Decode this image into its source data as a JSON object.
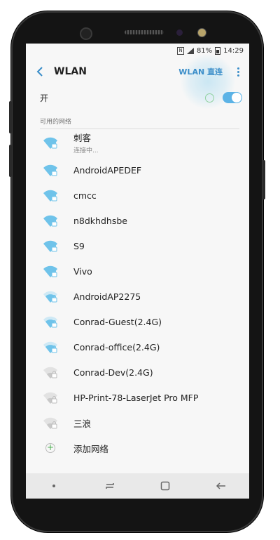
{
  "status_bar": {
    "nfc": "N",
    "battery_percent": "81%",
    "time": "14:29"
  },
  "app_bar": {
    "title": "WLAN",
    "wifi_direct_label": "WLAN 直连"
  },
  "master_switch": {
    "label": "开",
    "on": true
  },
  "section_header": "可用的网络",
  "networks": [
    {
      "name": "刺客",
      "status": "连接中..."
    },
    {
      "name": "AndroidAPEDEF"
    },
    {
      "name": "cmcc"
    },
    {
      "name": "n8dkhdhsbe"
    },
    {
      "name": "S9"
    },
    {
      "name": "Vivo"
    },
    {
      "name": "AndroidAP2275"
    },
    {
      "name": "Conrad-Guest(2.4G)"
    },
    {
      "name": "Conrad-office(2.4G)"
    },
    {
      "name": "Conrad-Dev(2.4G)"
    },
    {
      "name": "HP-Print-78-LaserJet Pro MFP"
    },
    {
      "name": "三浪"
    }
  ],
  "add_network": {
    "label": "添加网络",
    "icon": "plus-icon"
  },
  "colors": {
    "accent": "#3b8ec9",
    "toggle_on": "#5cb3e6",
    "wifi_strong": "#6fc3ea",
    "wifi_weak": "#c8c8c8"
  }
}
